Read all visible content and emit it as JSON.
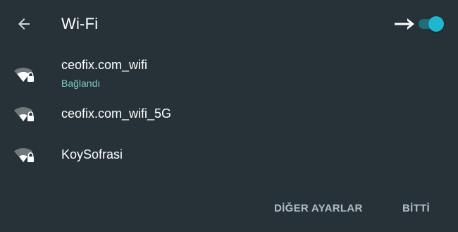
{
  "header": {
    "title": "Wi-Fi",
    "back_icon": "arrow-back-icon",
    "indicator_icon": "arrow-right-icon",
    "wifi_enabled": true
  },
  "networks": [
    {
      "name": "ceofix.com_wifi",
      "status": "Bağlandı",
      "secured": true,
      "icon": "wifi-lock-icon"
    },
    {
      "name": "ceofix.com_wifi_5G",
      "status": "",
      "secured": true,
      "icon": "wifi-lock-icon"
    },
    {
      "name": "KoySofrasi",
      "status": "",
      "secured": true,
      "icon": "wifi-lock-icon"
    }
  ],
  "actions": {
    "more_settings_label": "DİĞER AYARLAR",
    "done_label": "BİTTİ"
  },
  "colors": {
    "background": "#263238",
    "accent": "#1fb6cf",
    "status_text": "#80cbc4",
    "button_text": "#b0bec5"
  }
}
